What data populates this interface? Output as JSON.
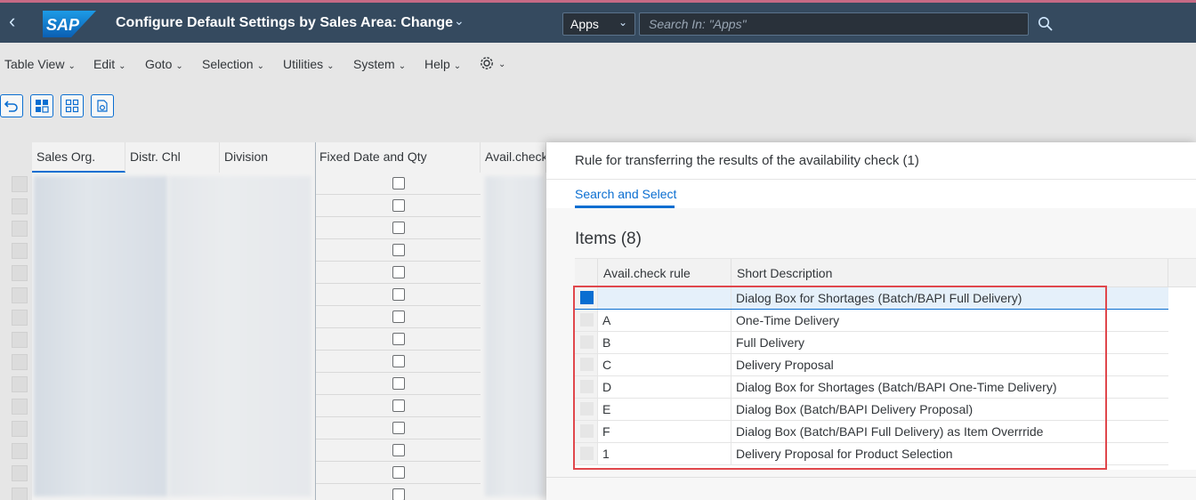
{
  "shell": {
    "logo_text": "SAP",
    "title": "Configure Default Settings by Sales Area: Change",
    "apps_select": "Apps",
    "search_placeholder": "Search In: \"Apps\"",
    "colors": {
      "background": "#354a5f",
      "accent_top": "#c66a85"
    }
  },
  "menu": {
    "items": [
      "Table View",
      "Edit",
      "Goto",
      "Selection",
      "Utilities",
      "System",
      "Help"
    ]
  },
  "toolbar": {
    "buttons": [
      "undo-icon",
      "select-all-icon",
      "deselect-all-icon",
      "export-icon"
    ]
  },
  "main_table": {
    "columns": [
      "Sales Org.",
      "Distr. Chl",
      "Division",
      "Fixed Date and Qty",
      "Avail.check"
    ]
  },
  "dialog": {
    "title": "Rule for transferring the results of the availability check (1)",
    "tab": "Search and Select",
    "items_title": "Items (8)",
    "columns": [
      "Avail.check rule",
      "Short Description"
    ],
    "rows": [
      {
        "rule": "",
        "description": "Dialog Box for Shortages (Batch/BAPI Full Delivery)",
        "selected": true
      },
      {
        "rule": "A",
        "description": "One-Time Delivery",
        "selected": false
      },
      {
        "rule": "B",
        "description": "Full Delivery",
        "selected": false
      },
      {
        "rule": "C",
        "description": "Delivery Proposal",
        "selected": false
      },
      {
        "rule": "D",
        "description": "Dialog Box for Shortages (Batch/BAPI One-Time Delivery)",
        "selected": false
      },
      {
        "rule": "E",
        "description": "Dialog Box (Batch/BAPI Delivery Proposal)",
        "selected": false
      },
      {
        "rule": "F",
        "description": "Dialog Box (Batch/BAPI Full Delivery) as Item Overrride",
        "selected": false
      },
      {
        "rule": "1",
        "description": "Delivery Proposal for Product Selection",
        "selected": false
      }
    ],
    "colors": {
      "accent": "#0a6ed1",
      "highlight": "#e0474c"
    }
  }
}
